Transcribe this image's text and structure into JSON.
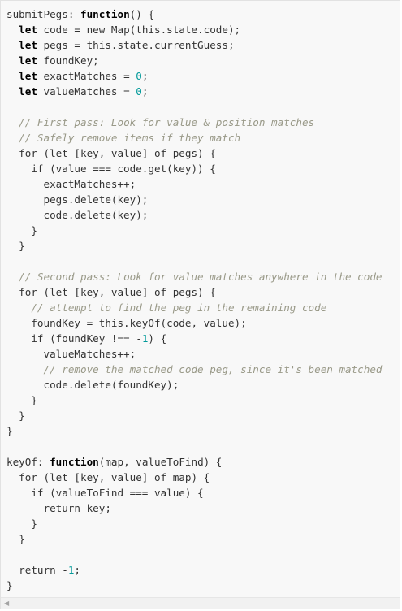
{
  "code": {
    "lines": [
      [
        {
          "t": "submitPegs: "
        },
        {
          "t": "function",
          "c": "kw"
        },
        {
          "t": "() {"
        }
      ],
      [
        {
          "t": "  "
        },
        {
          "t": "let",
          "c": "kw"
        },
        {
          "t": " code = new Map(this.state.code);"
        }
      ],
      [
        {
          "t": "  "
        },
        {
          "t": "let",
          "c": "kw"
        },
        {
          "t": " pegs = this.state.currentGuess;"
        }
      ],
      [
        {
          "t": "  "
        },
        {
          "t": "let",
          "c": "kw"
        },
        {
          "t": " foundKey;"
        }
      ],
      [
        {
          "t": "  "
        },
        {
          "t": "let",
          "c": "kw"
        },
        {
          "t": " exactMatches = "
        },
        {
          "t": "0",
          "c": "num"
        },
        {
          "t": ";"
        }
      ],
      [
        {
          "t": "  "
        },
        {
          "t": "let",
          "c": "kw"
        },
        {
          "t": " valueMatches = "
        },
        {
          "t": "0",
          "c": "num"
        },
        {
          "t": ";"
        }
      ],
      [],
      [
        {
          "t": "  "
        },
        {
          "t": "// First pass: Look for value & position matches",
          "c": "cm"
        }
      ],
      [
        {
          "t": "  "
        },
        {
          "t": "// Safely remove items if they match",
          "c": "cm"
        }
      ],
      [
        {
          "t": "  for (let [key, value] of pegs) {"
        }
      ],
      [
        {
          "t": "    if (value === code.get(key)) {"
        }
      ],
      [
        {
          "t": "      exactMatches++;"
        }
      ],
      [
        {
          "t": "      pegs.delete(key);"
        }
      ],
      [
        {
          "t": "      code.delete(key);"
        }
      ],
      [
        {
          "t": "    }"
        }
      ],
      [
        {
          "t": "  }"
        }
      ],
      [],
      [
        {
          "t": "  "
        },
        {
          "t": "// Second pass: Look for value matches anywhere in the code",
          "c": "cm"
        }
      ],
      [
        {
          "t": "  for (let [key, value] of pegs) {"
        }
      ],
      [
        {
          "t": "    "
        },
        {
          "t": "// attempt to find the peg in the remaining code",
          "c": "cm"
        }
      ],
      [
        {
          "t": "    foundKey = this.keyOf(code, value);"
        }
      ],
      [
        {
          "t": "    if (foundKey !== -"
        },
        {
          "t": "1",
          "c": "num"
        },
        {
          "t": ") {"
        }
      ],
      [
        {
          "t": "      valueMatches++;"
        }
      ],
      [
        {
          "t": "      "
        },
        {
          "t": "// remove the matched code peg, since it's been matched",
          "c": "cm"
        }
      ],
      [
        {
          "t": "      code.delete(foundKey);"
        }
      ],
      [
        {
          "t": "    }"
        }
      ],
      [
        {
          "t": "  }"
        }
      ],
      [
        {
          "t": "}"
        }
      ],
      [],
      [
        {
          "t": "keyOf: "
        },
        {
          "t": "function",
          "c": "kw"
        },
        {
          "t": "(map, valueToFind) {"
        }
      ],
      [
        {
          "t": "  for (let [key, value] of map) {"
        }
      ],
      [
        {
          "t": "    if (valueToFind === value) {"
        }
      ],
      [
        {
          "t": "      return key;"
        }
      ],
      [
        {
          "t": "    }"
        }
      ],
      [
        {
          "t": "  }"
        }
      ],
      [],
      [
        {
          "t": "  return -"
        },
        {
          "t": "1",
          "c": "num"
        },
        {
          "t": ";"
        }
      ],
      [
        {
          "t": "}"
        }
      ]
    ]
  },
  "scrollbar": {
    "left_arrow_glyph": "◀"
  }
}
